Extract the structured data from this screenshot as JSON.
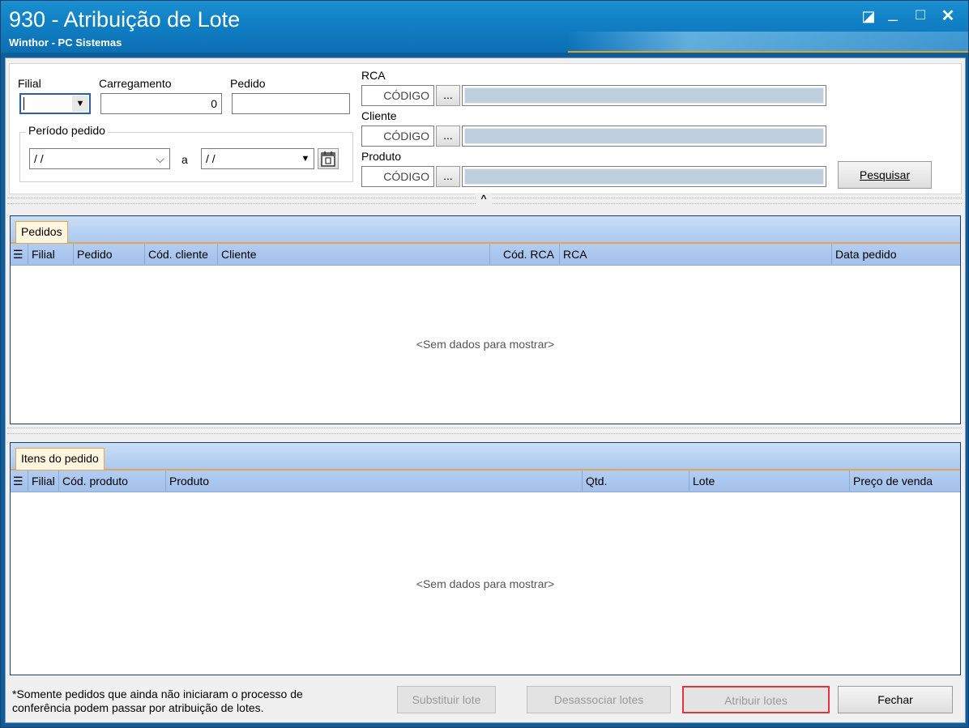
{
  "window": {
    "title": "930 - Atribuição de Lote",
    "subtitle": "Winthor - PC Sistemas",
    "controls": {
      "restore": "◪",
      "minimize": "_",
      "maximize": "☐",
      "close": "✕"
    }
  },
  "filters": {
    "filial_label": "Filial",
    "filial_value": "",
    "carregamento_label": "Carregamento",
    "carregamento_value": "0",
    "pedido_label": "Pedido",
    "pedido_value": "",
    "periodo_label": "Período pedido",
    "date_from": " / /",
    "date_sep": "a",
    "date_to": " / /",
    "rca_label": "RCA",
    "cliente_label": "Cliente",
    "produto_label": "Produto",
    "codigo_placeholder": "CÓDIGO",
    "ellipsis": "...",
    "search_button": "Pesquisar"
  },
  "pedidos_panel": {
    "tab": "Pedidos",
    "columns": [
      "Filial",
      "Pedido",
      "Cód. cliente",
      "Cliente",
      "Cód. RCA",
      "RCA",
      "Data pedido"
    ],
    "empty": "<Sem dados para mostrar>"
  },
  "itens_panel": {
    "tab": "Itens do pedido",
    "columns": [
      "Filial",
      "Cód. produto",
      "Produto",
      "Qtd.",
      "Lote",
      "Preço de venda"
    ],
    "empty": "<Sem dados para mostrar>"
  },
  "footer": {
    "note_line1": "*Somente pedidos que ainda não iniciaram o processo de",
    "note_line2": "conferência podem passar por atribuição de lotes.",
    "substituir": "Substituir lote",
    "desassociar": "Desassociar lotes",
    "atribuir": "Atribuir lotes",
    "fechar": "Fechar"
  },
  "colors": {
    "title_blue": "#107fc4",
    "accent_orange": "#e3a552",
    "highlight_red": "#e0353b"
  },
  "icons": [
    "restore-icon",
    "minimize-icon",
    "maximize-icon",
    "close-icon",
    "dropdown-arrow-icon",
    "calendar-icon",
    "collapse-chevron-icon",
    "grid-menu-icon"
  ]
}
